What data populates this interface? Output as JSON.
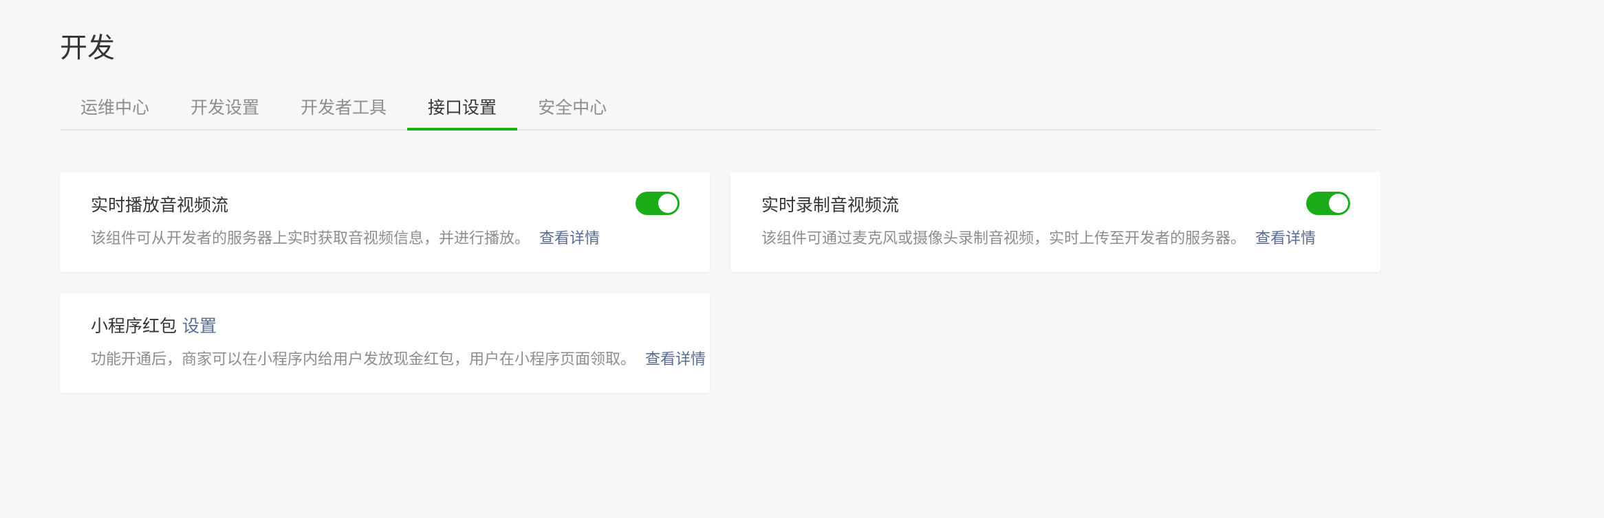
{
  "page": {
    "title": "开发"
  },
  "tabs": [
    {
      "label": "运维中心"
    },
    {
      "label": "开发设置"
    },
    {
      "label": "开发者工具"
    },
    {
      "label": "接口设置",
      "active": true
    },
    {
      "label": "安全中心"
    }
  ],
  "cards": {
    "live_player": {
      "title": "实时播放音视频流",
      "description": "该组件可从开发者的服务器上实时获取音视频信息，并进行播放。",
      "link": "查看详情",
      "enabled": true
    },
    "live_pusher": {
      "title": "实时录制音视频流",
      "description": "该组件可通过麦克风或摄像头录制音视频，实时上传至开发者的服务器。",
      "link": "查看详情",
      "enabled": true
    },
    "red_packet": {
      "title": "小程序红包",
      "settings_link": "设置",
      "description": "功能开通后，商家可以在小程序内给用户发放现金红包，用户在小程序页面领取。",
      "link": "查看详情"
    }
  },
  "colors": {
    "accent": "#1aad19",
    "link": "#576b95",
    "text_primary": "#353535",
    "text_secondary": "#8d8d8d",
    "background": "#f6f7f9"
  }
}
